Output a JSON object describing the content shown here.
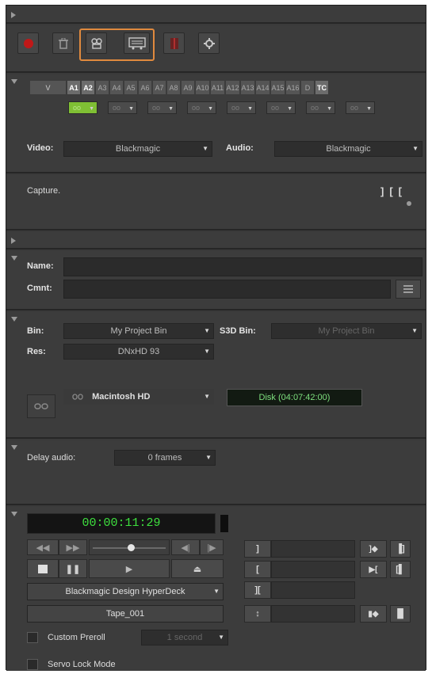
{
  "toolbar": {
    "icons": [
      "record-icon",
      "trash-icon",
      "capture-mode-icon",
      "log-mode-icon",
      "marker-icon",
      "settings-icon"
    ],
    "colors": {
      "record": "#c01818",
      "highlight": "#e08a3e"
    }
  },
  "tracks": {
    "items": [
      "V",
      "A1",
      "A2",
      "A3",
      "A4",
      "A5",
      "A6",
      "A7",
      "A8",
      "A9",
      "A10",
      "A11",
      "A12",
      "A13",
      "A14",
      "A15",
      "A16",
      "D",
      "TC"
    ],
    "selected": [
      "A1",
      "A2",
      "TC"
    ],
    "monitor_symbol": "oo"
  },
  "video_label": "Video:",
  "video_source": "Blackmagic",
  "audio_label": "Audio:",
  "audio_source": "Blackmagic",
  "capture_label": "Capture.",
  "name_label": "Name:",
  "cmnt_label": "Cmnt:",
  "bin_label": "Bin:",
  "bin_value": "My Project Bin",
  "s3d_label": "S3D Bin:",
  "s3d_value": "My Project Bin",
  "res_label": "Res:",
  "res_value": "DNxHD 93",
  "disk_name": "Macintosh HD",
  "disk_status": "Disk (04:07:42:00)",
  "delay_label": "Delay audio:",
  "delay_value": "0 frames",
  "timecode": "00:00:11:29",
  "deck_name": "Blackmagic Design HyperDeck",
  "tape_name": "Tape_001",
  "preroll_label": "Custom Preroll",
  "preroll_value": "1 second",
  "servo_label": "Servo Lock Mode",
  "colors": {
    "timecode": "#3ee03e",
    "disk_status": "#7ee07e"
  }
}
